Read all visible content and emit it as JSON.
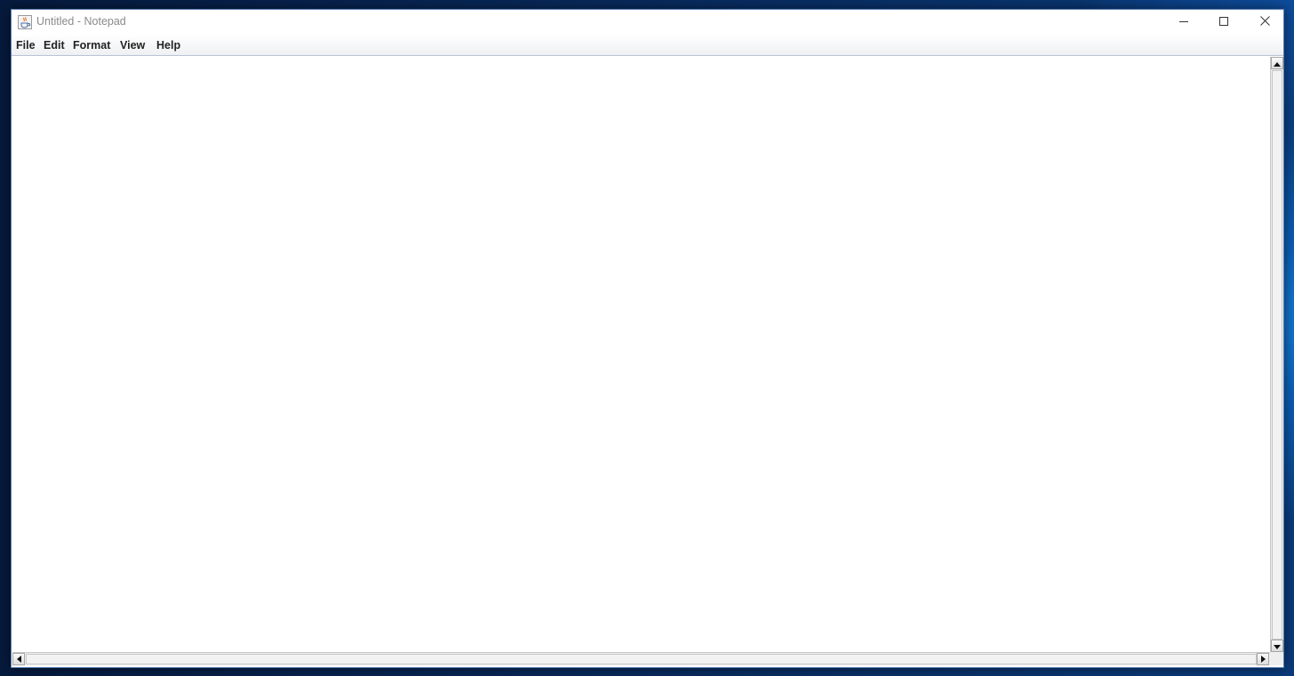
{
  "window": {
    "title": "Untitled - Notepad",
    "controls": [
      "minimize",
      "maximize",
      "close"
    ]
  },
  "menubar": {
    "items": [
      {
        "label": "File"
      },
      {
        "label": "Edit"
      },
      {
        "label": "Format"
      },
      {
        "label": "View"
      },
      {
        "label": "Help"
      }
    ]
  },
  "editor": {
    "content": ""
  },
  "icons": {
    "app": "java-cup-icon",
    "minimize": "minimize-icon",
    "maximize": "maximize-icon",
    "close": "close-icon",
    "scroll_up": "arrow-up-icon",
    "scroll_down": "arrow-down-icon",
    "scroll_left": "arrow-left-icon",
    "scroll_right": "arrow-right-icon"
  },
  "colors": {
    "title_text": "#8a8a8a",
    "menubar_border": "#b9c4d3",
    "window_border": "#5a7fb3"
  }
}
